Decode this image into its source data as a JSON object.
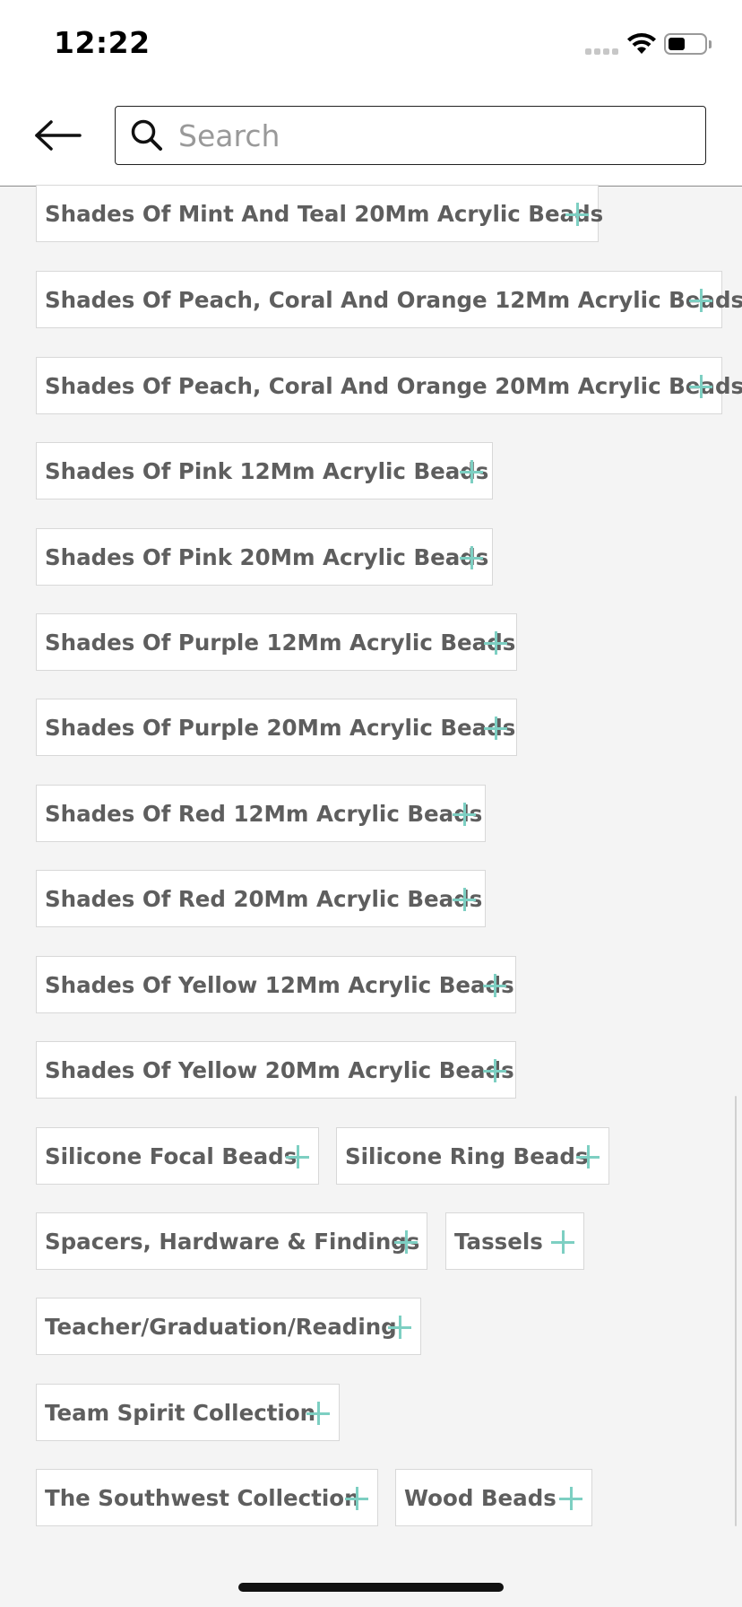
{
  "status_bar": {
    "time": "12:22"
  },
  "header": {
    "search": {
      "placeholder": "Search",
      "value": ""
    }
  },
  "icons": {
    "back": "arrow-left-icon",
    "search": "search-icon",
    "add": "plus-icon",
    "wifi": "wifi-icon",
    "battery": "battery-icon",
    "signal": "signal-icon"
  },
  "colors": {
    "accent": "#7dcfc2",
    "tag_text": "#5e5e5e",
    "background": "#f4f4f4"
  },
  "tags": [
    {
      "label": "Shades Of Mint And Teal 20Mm Acrylic Beads"
    },
    {
      "label": "Shades Of Peach, Coral And Orange 12Mm Acrylic Beads"
    },
    {
      "label": "Shades Of Peach, Coral And Orange 20Mm Acrylic Beads"
    },
    {
      "label": "Shades Of Pink 12Mm Acrylic Beads"
    },
    {
      "label": "Shades Of Pink 20Mm Acrylic Beads"
    },
    {
      "label": "Shades Of Purple 12Mm Acrylic Beads"
    },
    {
      "label": "Shades Of Purple 20Mm Acrylic Beads"
    },
    {
      "label": "Shades Of Red 12Mm Acrylic Beads"
    },
    {
      "label": "Shades Of Red 20Mm Acrylic Beads"
    },
    {
      "label": "Shades Of Yellow 12Mm Acrylic Beads"
    },
    {
      "label": "Shades Of Yellow 20Mm Acrylic Beads"
    },
    {
      "label": "Silicone Focal Beads"
    },
    {
      "label": "Silicone Ring Beads"
    },
    {
      "label": "Spacers, Hardware & Findings"
    },
    {
      "label": "Tassels"
    },
    {
      "label": "Teacher/Graduation/Reading"
    },
    {
      "label": "Team Spirit Collection"
    },
    {
      "label": "The Southwest Collection"
    },
    {
      "label": "Wood Beads"
    }
  ]
}
